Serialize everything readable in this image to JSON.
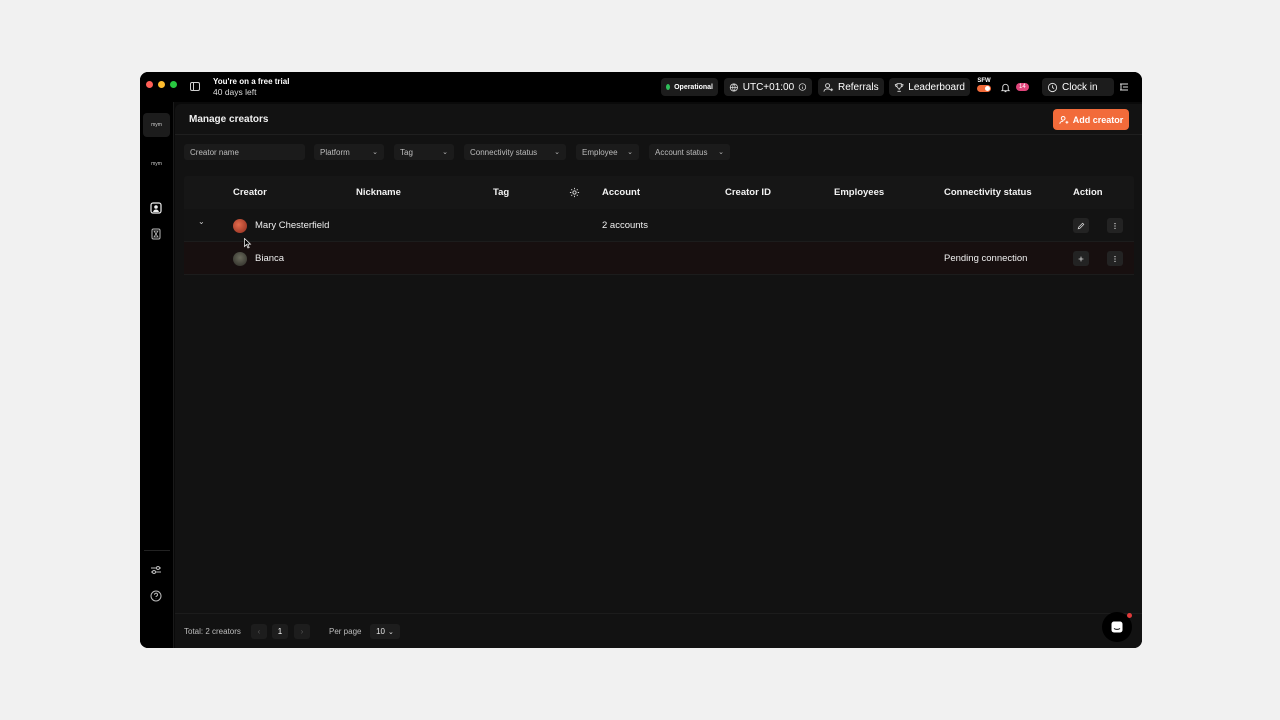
{
  "titlebar": {
    "trial_line1": "You're on a free trial",
    "trial_line2": "40 days left",
    "status": "Operational",
    "timezone": "UTC+01:00",
    "referrals": "Referrals",
    "leaderboard": "Leaderboard",
    "sfw": "SFW",
    "notifications_count": "14",
    "clock_in": "Clock in"
  },
  "sidebar": {
    "logo_text": "mym",
    "icons": [
      "user-icon",
      "hourglass-icon",
      "sliders-icon",
      "help-icon"
    ]
  },
  "page": {
    "title": "Manage creators",
    "add_button": "Add creator"
  },
  "filters": {
    "creator_name_placeholder": "Creator name",
    "platform": "Platform",
    "tag": "Tag",
    "connectivity_status": "Connectivity status",
    "employee": "Employee",
    "account_status": "Account status"
  },
  "table": {
    "headers": {
      "creator": "Creator",
      "nickname": "Nickname",
      "tag": "Tag",
      "account": "Account",
      "creator_id": "Creator ID",
      "employees": "Employees",
      "connectivity": "Connectivity status",
      "action": "Action"
    },
    "rows": [
      {
        "creator": "Mary Chesterfield",
        "account": "2 accounts",
        "connectivity": ""
      },
      {
        "creator": "Bianca",
        "account": "",
        "connectivity": "Pending connection"
      }
    ]
  },
  "footer": {
    "total": "Total: 2 creators",
    "prev": "‹",
    "page": "1",
    "next": "›",
    "per_page_label": "Per page",
    "per_page_value": "10"
  },
  "colors": {
    "accent": "#f26b3a",
    "status_green": "#2fbf5a",
    "badge_pink": "#e0457b"
  }
}
